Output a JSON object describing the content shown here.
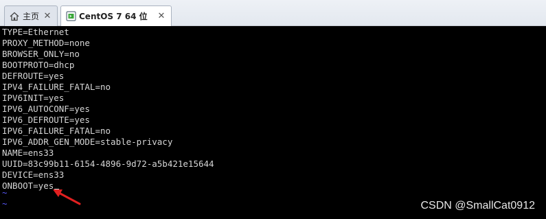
{
  "tabs": [
    {
      "label": "主页",
      "icon": "home-icon",
      "active": false
    },
    {
      "label": "CentOS 7 64 位",
      "icon": "vm-icon",
      "active": true
    }
  ],
  "terminal": {
    "lines": [
      "TYPE=Ethernet",
      "PROXY_METHOD=none",
      "BROWSER_ONLY=no",
      "BOOTPROTO=dhcp",
      "DEFROUTE=yes",
      "IPV4_FAILURE_FATAL=no",
      "IPV6INIT=yes",
      "IPV6_AUTOCONF=yes",
      "IPV6_DEFROUTE=yes",
      "IPV6_FAILURE_FATAL=no",
      "IPV6_ADDR_GEN_MODE=stable-privacy",
      "NAME=ens33",
      "UUID=83c99b11-6154-4896-9d72-a5b421e15644",
      "DEVICE=ens33",
      "ONBOOT=yes"
    ],
    "tildes": [
      "~",
      "~"
    ],
    "colors": {
      "background": "#000000",
      "text": "#d6d6d6",
      "tilde": "#5a5aff",
      "arrow": "#e02020"
    }
  },
  "watermark": "CSDN @SmallCat0912"
}
